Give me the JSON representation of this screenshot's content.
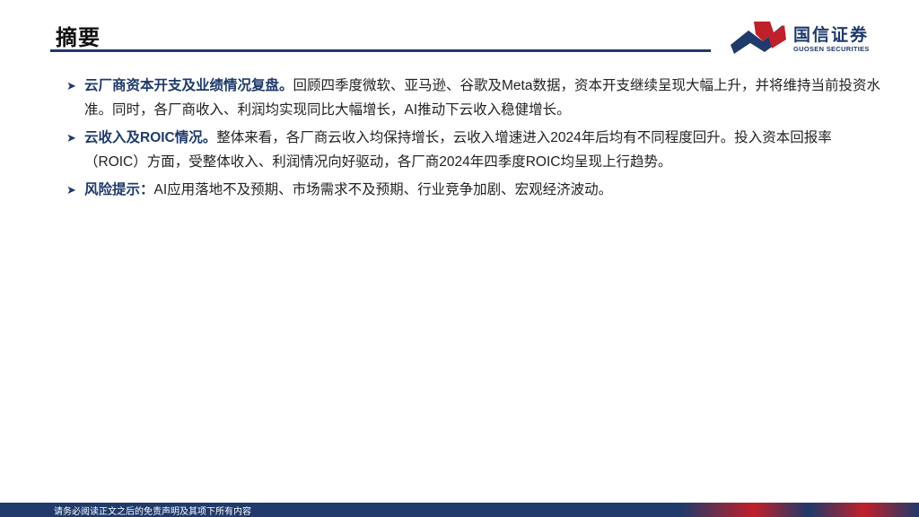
{
  "header": {
    "title": "摘要",
    "logo_cn": "国信证券",
    "logo_en": "GUOSEN SECURITIES"
  },
  "bullets": [
    {
      "lead": "云厂商资本开支及业绩情况复盘。",
      "text": "回顾四季度微软、亚马逊、谷歌及Meta数据，资本开支继续呈现大幅上升，并将维持当前投资水准。同时，各厂商收入、利润均实现同比大幅增长，AI推动下云收入稳健增长。"
    },
    {
      "lead": "云收入及ROIC情况。",
      "text": "整体来看，各厂商云收入均保持增长，云收入增速进入2024年后均有不同程度回升。投入资本回报率（ROIC）方面，受整体收入、利润情况向好驱动，各厂商2024年四季度ROIC均呈现上行趋势。"
    },
    {
      "lead": "风险提示：",
      "text": "AI应用落地不及预期、市场需求不及预期、行业竞争加剧、宏观经济波动。"
    }
  ],
  "footer": {
    "disclaimer": "请务必阅读正文之后的免责声明及其项下所有内容"
  },
  "colors": {
    "brand_blue": "#1f3a6b",
    "brand_red": "#c0202a"
  },
  "icons": {
    "bullet": "triangle-right-icon",
    "logo": "guosen-logo-icon"
  }
}
